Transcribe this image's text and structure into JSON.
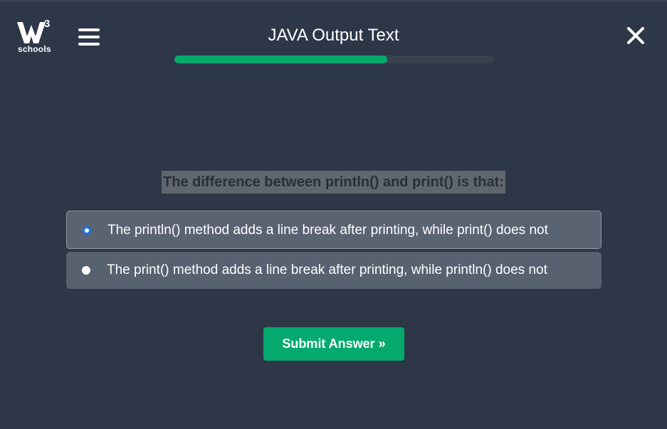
{
  "header": {
    "logo_superscript": "3",
    "logo_text": "schools",
    "title": "JAVA Output Text",
    "progress_fraction": 0.665
  },
  "quiz": {
    "question": "The difference between println() and print() is that:",
    "options": [
      {
        "label": "The println() method adds a line break after printing, while print() does not",
        "selected": true
      },
      {
        "label": "The print() method adds a line break after printing, while println() does not",
        "selected": false
      }
    ],
    "submit_label": "Submit Answer »"
  },
  "colors": {
    "background": "#2d3748",
    "accent": "#04aa6d",
    "option_bg": "#576170",
    "radio_selected": "#1a73e8"
  }
}
